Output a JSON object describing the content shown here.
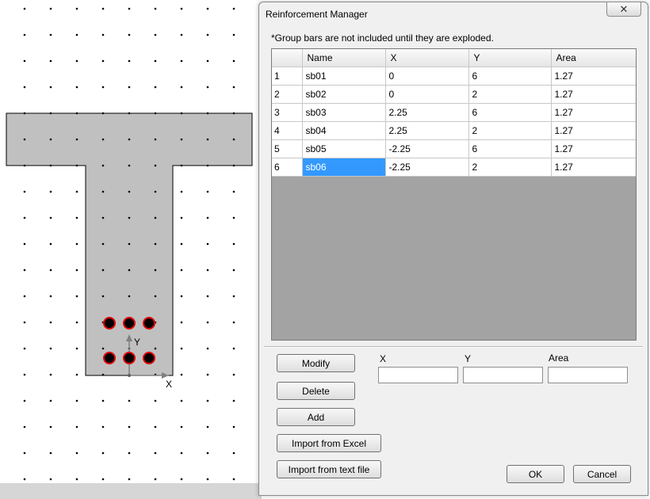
{
  "canvas": {
    "axis_y_label": "Y",
    "axis_x_label": "X",
    "section_fill": "#c0c0c0",
    "bar_color": "#e00000"
  },
  "dialog": {
    "title": "Reinforcement Manager",
    "close_icon": "close-icon",
    "note": "*Group bars are not included until they are exploded.",
    "table": {
      "columns": [
        "Name",
        "X",
        "Y",
        "Area"
      ],
      "rows": [
        {
          "index": "1",
          "name": "sb01",
          "x": "0",
          "y": "6",
          "area": "1.27"
        },
        {
          "index": "2",
          "name": "sb02",
          "x": "0",
          "y": "2",
          "area": "1.27"
        },
        {
          "index": "3",
          "name": "sb03",
          "x": "2.25",
          "y": "6",
          "area": "1.27"
        },
        {
          "index": "4",
          "name": "sb04",
          "x": "2.25",
          "y": "2",
          "area": "1.27"
        },
        {
          "index": "5",
          "name": "sb05",
          "x": "-2.25",
          "y": "6",
          "area": "1.27"
        },
        {
          "index": "6",
          "name": "sb06",
          "x": "-2.25",
          "y": "2",
          "area": "1.27"
        }
      ],
      "selected_row": 5
    },
    "buttons": {
      "modify": "Modify",
      "delete": "Delete",
      "add": "Add",
      "import_excel": "Import from Excel",
      "import_text": "Import from text file",
      "ok": "OK",
      "cancel": "Cancel"
    },
    "fields": {
      "x_label": "X",
      "y_label": "Y",
      "area_label": "Area",
      "x_value": "",
      "y_value": "",
      "area_value": ""
    }
  }
}
